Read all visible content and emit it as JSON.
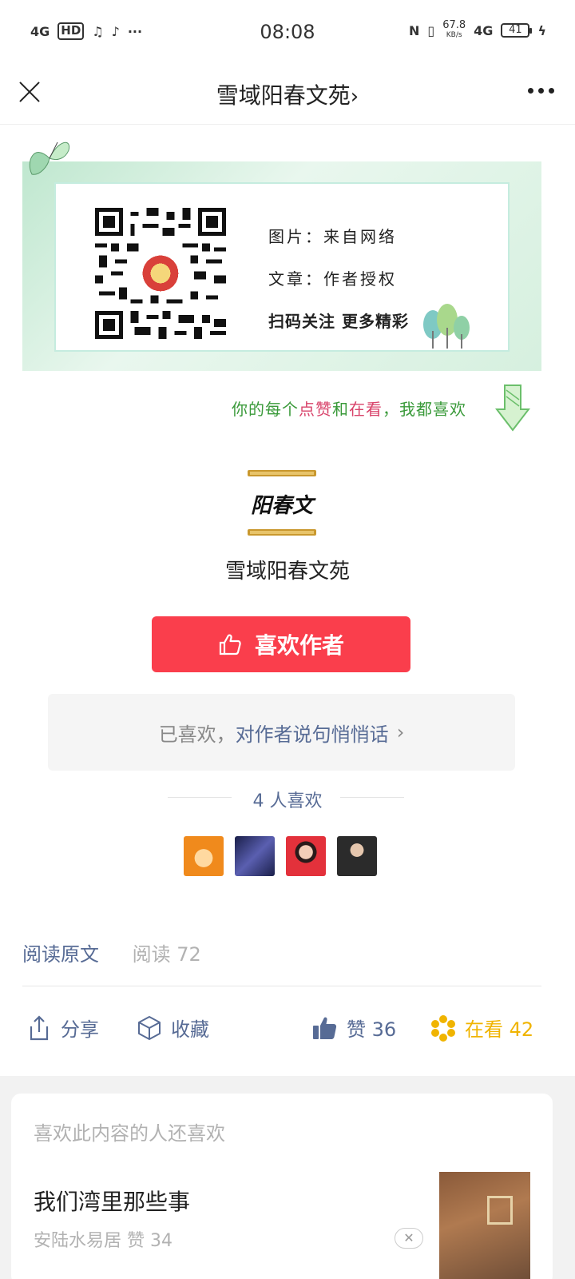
{
  "status_bar": {
    "network": "4G",
    "hd": "HD",
    "time": "08:08",
    "nfc": "N",
    "speed": "67.8",
    "speed_unit": "KB/s",
    "net2": "4G",
    "battery": "41",
    "more": "···"
  },
  "titlebar": {
    "title": "雪域阳春文苑",
    "chevron": "›"
  },
  "banner": {
    "line1": "图片：来自网络",
    "line2": "文章：作者授权",
    "line3": "扫码关注 更多精彩"
  },
  "like_hint": {
    "part1": "你的每个",
    "part2": "点赞",
    "part3": "和",
    "part4": "在看",
    "part5": "，我都喜欢"
  },
  "author": {
    "logo_text": "阳春文",
    "name": "雪域阳春文苑",
    "like_button": "喜欢作者",
    "whisper_prefix": "已喜欢，",
    "whisper_link": "对作者说句悄悄话",
    "whisper_chevron": "›",
    "likers_count": "4 人喜欢"
  },
  "footer": {
    "read_original": "阅读原文",
    "read_count": "阅读 72",
    "share": "分享",
    "favorite": "收藏",
    "like": "赞 36",
    "watching": "在看 42"
  },
  "recommend": {
    "header": "喜欢此内容的人还喜欢",
    "title": "我们湾里那些事",
    "meta": "安陆水易居    赞 34",
    "close": "✕"
  },
  "colors": {
    "accent_red": "#fa3e4c",
    "link_blue": "#576b95",
    "watch_yellow": "#f0b400",
    "hint_green": "#3a9a3a",
    "hint_pink": "#d8436a"
  },
  "icons": [
    "close-icon",
    "more-icon",
    "thumb-up-icon",
    "share-icon",
    "favorite-icon",
    "like-icon",
    "watching-icon",
    "butterfly-icon",
    "arrow-down-icon",
    "qr-code"
  ]
}
